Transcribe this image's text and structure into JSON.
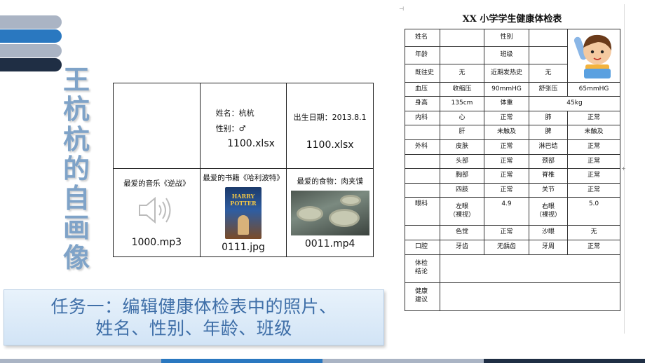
{
  "title_vertical": "王杭杭的自画像",
  "profile": {
    "name_line": "姓名：杭杭",
    "gender_line": "性别：♂",
    "birth_line": "出生日期：2013.8.1",
    "file1": "1100.xlsx",
    "file2": "1100.xlsx",
    "music_label": "最爱的音乐《逆战》",
    "music_file": "1000.mp3",
    "book_label": "最爱的书籍《哈利波特》",
    "book_cover_text": "HARRY POTTER",
    "book_file": "0111.jpg",
    "food_label": "最爱的食物：肉夹馍",
    "food_file": "0011.mp4"
  },
  "form": {
    "title": "XX 小学学生健康体检表",
    "r1": [
      "姓名",
      "",
      "性别",
      ""
    ],
    "r2": [
      "年龄",
      "",
      "班级",
      ""
    ],
    "r3": [
      "既往史",
      "无",
      "近期发热史",
      "无"
    ],
    "r4": [
      "血压",
      "收缩压",
      "90mmHG",
      "舒张压",
      "65mmHG"
    ],
    "r5": [
      "身高",
      "135cm",
      "体重",
      "45kg"
    ],
    "r6": [
      "内科",
      "心",
      "正常",
      "肺",
      "正常"
    ],
    "r7": [
      "",
      "肝",
      "未触及",
      "脾",
      "未触及"
    ],
    "r8": [
      "外科",
      "皮肤",
      "正常",
      "淋巴结",
      "正常"
    ],
    "r9": [
      "",
      "头部",
      "正常",
      "颈部",
      "正常"
    ],
    "r10": [
      "",
      "胸部",
      "正常",
      "脊椎",
      "正常"
    ],
    "r11": [
      "",
      "四肢",
      "正常",
      "关节",
      "正常"
    ],
    "r12": [
      "眼科",
      "左眼",
      "（裸视）",
      "4.9",
      "右眼",
      "（裸视）",
      "5.0"
    ],
    "r13": [
      "",
      "色觉",
      "正常",
      "沙眼",
      "无"
    ],
    "r14": [
      "口腔",
      "牙齿",
      "无龋齿",
      "牙周",
      "正常"
    ],
    "r15": [
      "体检",
      "结论"
    ],
    "r16": [
      "健康",
      "建议"
    ]
  },
  "task": {
    "line1": "任务一：编辑健康体检表中的照片、",
    "line2": "姓名、性别、年龄、班级"
  },
  "colors": {
    "accent_blue": "#2a78c0",
    "stripe_gray": "#aab4c4",
    "navy": "#1f2e44",
    "title_blue": "#7fa3c8"
  }
}
